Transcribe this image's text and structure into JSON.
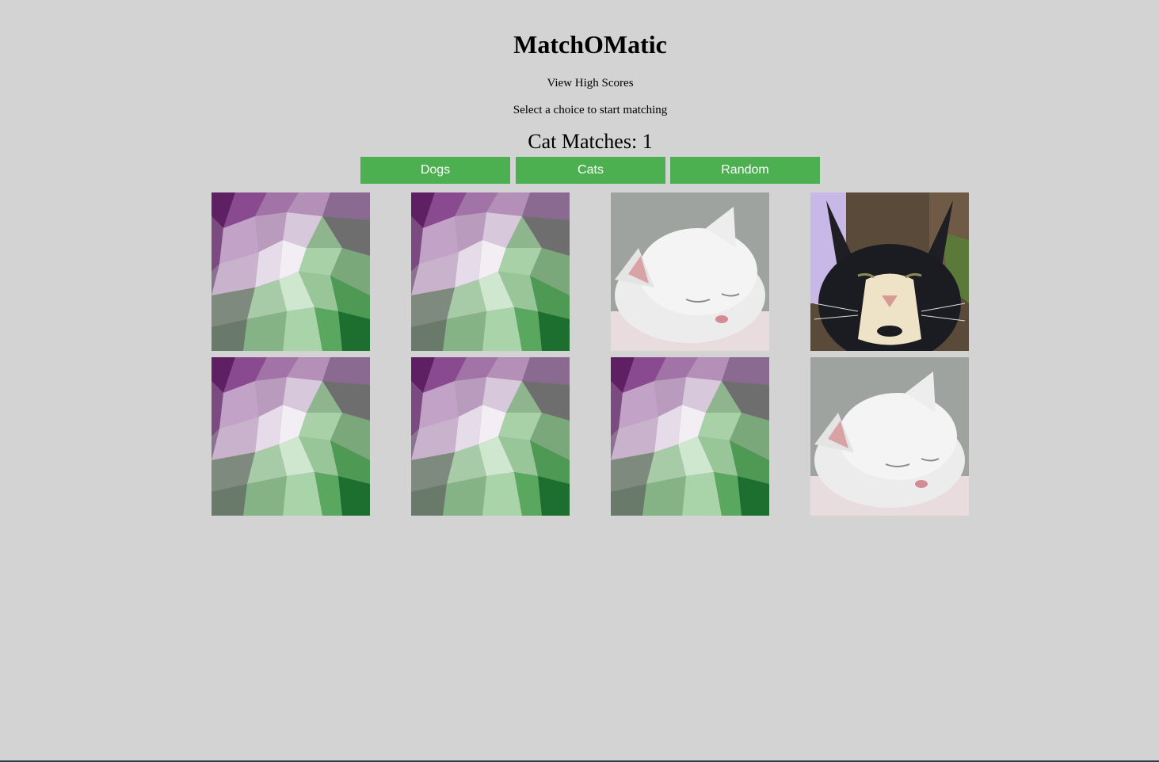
{
  "app": {
    "title": "MatchOMatic",
    "high_scores_link": "View High Scores",
    "instruction": "Select a choice to start matching",
    "matches_label": "Cat Matches: 1"
  },
  "choices": [
    {
      "label": "Dogs"
    },
    {
      "label": "Cats"
    },
    {
      "label": "Random"
    }
  ],
  "colors": {
    "background": "#d3d3d3",
    "button": "#4caf50",
    "button_text": "#ffffff"
  },
  "cards": [
    {
      "state": "face-down",
      "icon": "card-back-pattern"
    },
    {
      "state": "face-down",
      "icon": "card-back-pattern"
    },
    {
      "state": "face-up",
      "icon": "sleeping-white-cat-photo"
    },
    {
      "state": "face-up",
      "icon": "tuxedo-cat-photo"
    },
    {
      "state": "face-down",
      "icon": "card-back-pattern"
    },
    {
      "state": "face-down",
      "icon": "card-back-pattern"
    },
    {
      "state": "face-down",
      "icon": "card-back-pattern"
    },
    {
      "state": "face-up",
      "icon": "sleeping-white-cat-photo"
    }
  ]
}
